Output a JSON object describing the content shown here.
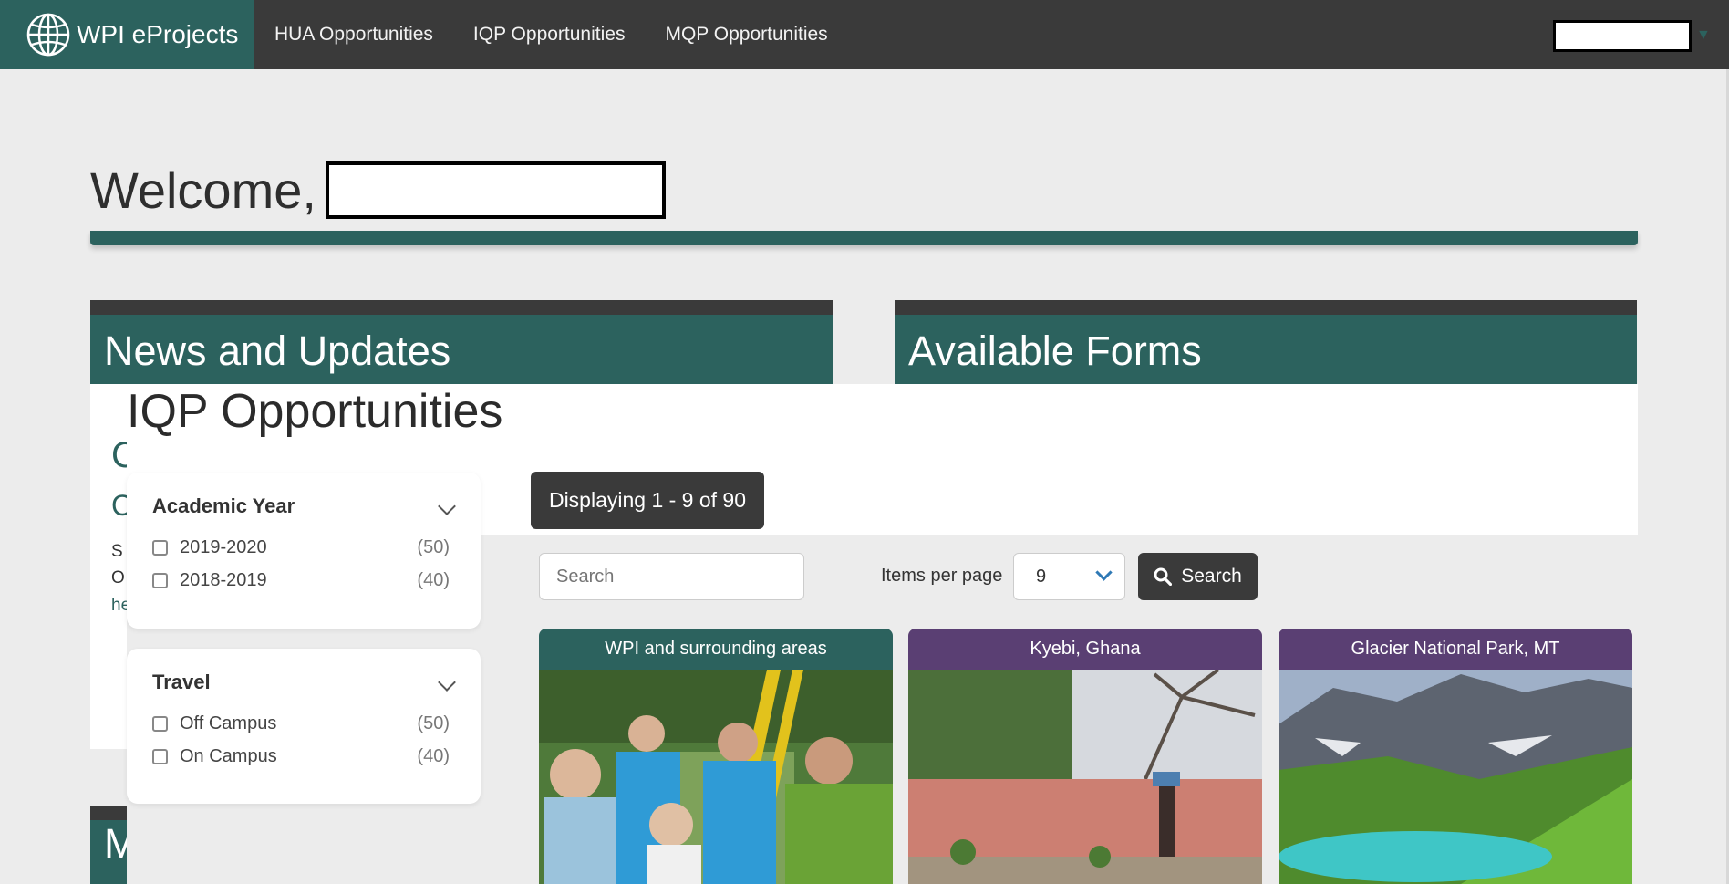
{
  "navbar": {
    "brand": "WPI eProjects",
    "links": [
      "HUA Opportunities",
      "IQP Opportunities",
      "MQP Opportunities"
    ]
  },
  "welcome": {
    "text": "Welcome,"
  },
  "panels": {
    "news_title": "News and Updates",
    "forms_title": "Available Forms",
    "bottom_title_fragment": "M",
    "news_fragments": [
      "C",
      "C",
      "S",
      "O",
      "he"
    ]
  },
  "overlay": {
    "title": "IQP Opportunities",
    "filters": [
      {
        "title": "Academic Year",
        "options": [
          {
            "label": "2019-2020",
            "count": "(50)"
          },
          {
            "label": "2018-2019",
            "count": "(40)"
          }
        ]
      },
      {
        "title": "Travel",
        "options": [
          {
            "label": "Off Campus",
            "count": "(50)"
          },
          {
            "label": "On Campus",
            "count": "(40)"
          }
        ]
      }
    ],
    "display_count": "Displaying 1 - 9 of 90",
    "search_placeholder": "Search",
    "items_per_page_label": "Items per page",
    "items_per_page_value": "9",
    "search_button": "Search",
    "cards": [
      {
        "location": "WPI and surrounding areas",
        "header_color": "#2c625e"
      },
      {
        "location": "Kyebi, Ghana",
        "header_color": "#5a3f73"
      },
      {
        "location": "Glacier National Park, MT",
        "header_color": "#5a3f73"
      }
    ]
  },
  "colors": {
    "nav": "#3a3a3a",
    "brand": "#2c625e",
    "accent_purple": "#5a3f73",
    "page_bg": "#ececec"
  },
  "icons": [
    "globe-icon",
    "chevron-down-icon",
    "search-icon"
  ]
}
